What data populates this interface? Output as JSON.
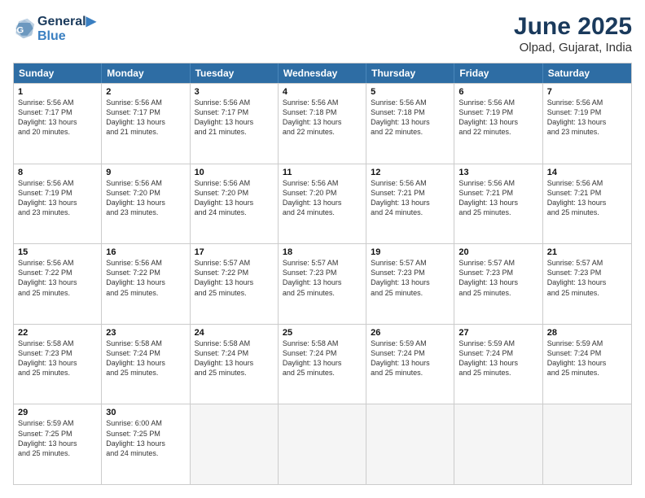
{
  "logo": {
    "line1": "General",
    "line2": "Blue"
  },
  "title": "June 2025",
  "subtitle": "Olpad, Gujarat, India",
  "headers": [
    "Sunday",
    "Monday",
    "Tuesday",
    "Wednesday",
    "Thursday",
    "Friday",
    "Saturday"
  ],
  "rows": [
    [
      {
        "day": "",
        "info": ""
      },
      {
        "day": "2",
        "info": "Sunrise: 5:56 AM\nSunset: 7:17 PM\nDaylight: 13 hours\nand 21 minutes."
      },
      {
        "day": "3",
        "info": "Sunrise: 5:56 AM\nSunset: 7:17 PM\nDaylight: 13 hours\nand 21 minutes."
      },
      {
        "day": "4",
        "info": "Sunrise: 5:56 AM\nSunset: 7:18 PM\nDaylight: 13 hours\nand 22 minutes."
      },
      {
        "day": "5",
        "info": "Sunrise: 5:56 AM\nSunset: 7:18 PM\nDaylight: 13 hours\nand 22 minutes."
      },
      {
        "day": "6",
        "info": "Sunrise: 5:56 AM\nSunset: 7:19 PM\nDaylight: 13 hours\nand 22 minutes."
      },
      {
        "day": "7",
        "info": "Sunrise: 5:56 AM\nSunset: 7:19 PM\nDaylight: 13 hours\nand 23 minutes."
      }
    ],
    [
      {
        "day": "8",
        "info": "Sunrise: 5:56 AM\nSunset: 7:19 PM\nDaylight: 13 hours\nand 23 minutes."
      },
      {
        "day": "9",
        "info": "Sunrise: 5:56 AM\nSunset: 7:20 PM\nDaylight: 13 hours\nand 23 minutes."
      },
      {
        "day": "10",
        "info": "Sunrise: 5:56 AM\nSunset: 7:20 PM\nDaylight: 13 hours\nand 24 minutes."
      },
      {
        "day": "11",
        "info": "Sunrise: 5:56 AM\nSunset: 7:20 PM\nDaylight: 13 hours\nand 24 minutes."
      },
      {
        "day": "12",
        "info": "Sunrise: 5:56 AM\nSunset: 7:21 PM\nDaylight: 13 hours\nand 24 minutes."
      },
      {
        "day": "13",
        "info": "Sunrise: 5:56 AM\nSunset: 7:21 PM\nDaylight: 13 hours\nand 25 minutes."
      },
      {
        "day": "14",
        "info": "Sunrise: 5:56 AM\nSunset: 7:21 PM\nDaylight: 13 hours\nand 25 minutes."
      }
    ],
    [
      {
        "day": "15",
        "info": "Sunrise: 5:56 AM\nSunset: 7:22 PM\nDaylight: 13 hours\nand 25 minutes."
      },
      {
        "day": "16",
        "info": "Sunrise: 5:56 AM\nSunset: 7:22 PM\nDaylight: 13 hours\nand 25 minutes."
      },
      {
        "day": "17",
        "info": "Sunrise: 5:57 AM\nSunset: 7:22 PM\nDaylight: 13 hours\nand 25 minutes."
      },
      {
        "day": "18",
        "info": "Sunrise: 5:57 AM\nSunset: 7:23 PM\nDaylight: 13 hours\nand 25 minutes."
      },
      {
        "day": "19",
        "info": "Sunrise: 5:57 AM\nSunset: 7:23 PM\nDaylight: 13 hours\nand 25 minutes."
      },
      {
        "day": "20",
        "info": "Sunrise: 5:57 AM\nSunset: 7:23 PM\nDaylight: 13 hours\nand 25 minutes."
      },
      {
        "day": "21",
        "info": "Sunrise: 5:57 AM\nSunset: 7:23 PM\nDaylight: 13 hours\nand 25 minutes."
      }
    ],
    [
      {
        "day": "22",
        "info": "Sunrise: 5:58 AM\nSunset: 7:23 PM\nDaylight: 13 hours\nand 25 minutes."
      },
      {
        "day": "23",
        "info": "Sunrise: 5:58 AM\nSunset: 7:24 PM\nDaylight: 13 hours\nand 25 minutes."
      },
      {
        "day": "24",
        "info": "Sunrise: 5:58 AM\nSunset: 7:24 PM\nDaylight: 13 hours\nand 25 minutes."
      },
      {
        "day": "25",
        "info": "Sunrise: 5:58 AM\nSunset: 7:24 PM\nDaylight: 13 hours\nand 25 minutes."
      },
      {
        "day": "26",
        "info": "Sunrise: 5:59 AM\nSunset: 7:24 PM\nDaylight: 13 hours\nand 25 minutes."
      },
      {
        "day": "27",
        "info": "Sunrise: 5:59 AM\nSunset: 7:24 PM\nDaylight: 13 hours\nand 25 minutes."
      },
      {
        "day": "28",
        "info": "Sunrise: 5:59 AM\nSunset: 7:24 PM\nDaylight: 13 hours\nand 25 minutes."
      }
    ],
    [
      {
        "day": "29",
        "info": "Sunrise: 5:59 AM\nSunset: 7:25 PM\nDaylight: 13 hours\nand 25 minutes."
      },
      {
        "day": "30",
        "info": "Sunrise: 6:00 AM\nSunset: 7:25 PM\nDaylight: 13 hours\nand 24 minutes."
      },
      {
        "day": "",
        "info": ""
      },
      {
        "day": "",
        "info": ""
      },
      {
        "day": "",
        "info": ""
      },
      {
        "day": "",
        "info": ""
      },
      {
        "day": "",
        "info": ""
      }
    ]
  ],
  "first_row_first": {
    "day": "1",
    "info": "Sunrise: 5:56 AM\nSunset: 7:17 PM\nDaylight: 13 hours\nand 20 minutes."
  }
}
